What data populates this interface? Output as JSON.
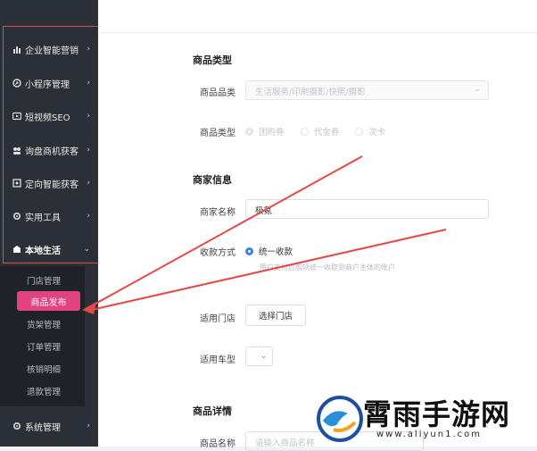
{
  "sidebar": {
    "items": [
      {
        "label": "企业智能营销",
        "icon": "bar-chart-icon"
      },
      {
        "label": "小程序管理",
        "icon": "compass-icon"
      },
      {
        "label": "短视频SEO",
        "icon": "video-icon"
      },
      {
        "label": "询盘商机获客",
        "icon": "users-icon"
      },
      {
        "label": "定向智能获客",
        "icon": "target-icon"
      },
      {
        "label": "实用工具",
        "icon": "gear-icon"
      },
      {
        "label": "本地生活",
        "icon": "store-icon"
      }
    ],
    "submenu": [
      "门店管理",
      "商品发布",
      "货架管理",
      "订单管理",
      "核销明细",
      "退款管理"
    ],
    "active_sub": "商品发布",
    "footer_item": {
      "label": "系统管理",
      "icon": "settings-icon"
    }
  },
  "form": {
    "section_product_type": "商品类型",
    "category_label": "商品品类",
    "category_value": "生活服务/印刷摄影/快照/摄影",
    "type_label": "商品类型",
    "type_options": [
      "团购券",
      "代金券",
      "次卡"
    ],
    "section_merchant": "商家信息",
    "merchant_name_label": "商家名称",
    "merchant_name_value": "极氪",
    "payment_label": "收款方式",
    "payment_option": "统一收款",
    "payment_hint": "用户支付后款项统一收取到商户主体的账户",
    "store_label": "适用门店",
    "store_button": "选择门店",
    "car_label": "适用车型",
    "section_details": "商品详情",
    "product_name_label": "商品名称",
    "product_name_placeholder": "请输入商品名称"
  },
  "watermark": {
    "brand": "霄雨手游网",
    "url": "www.aliyun1.com"
  },
  "colors": {
    "sidebar_bg": "#2b3036",
    "active_pink": "#e0437f",
    "accent_blue": "#3b82f6",
    "annotation_red": "#e24a4a"
  }
}
